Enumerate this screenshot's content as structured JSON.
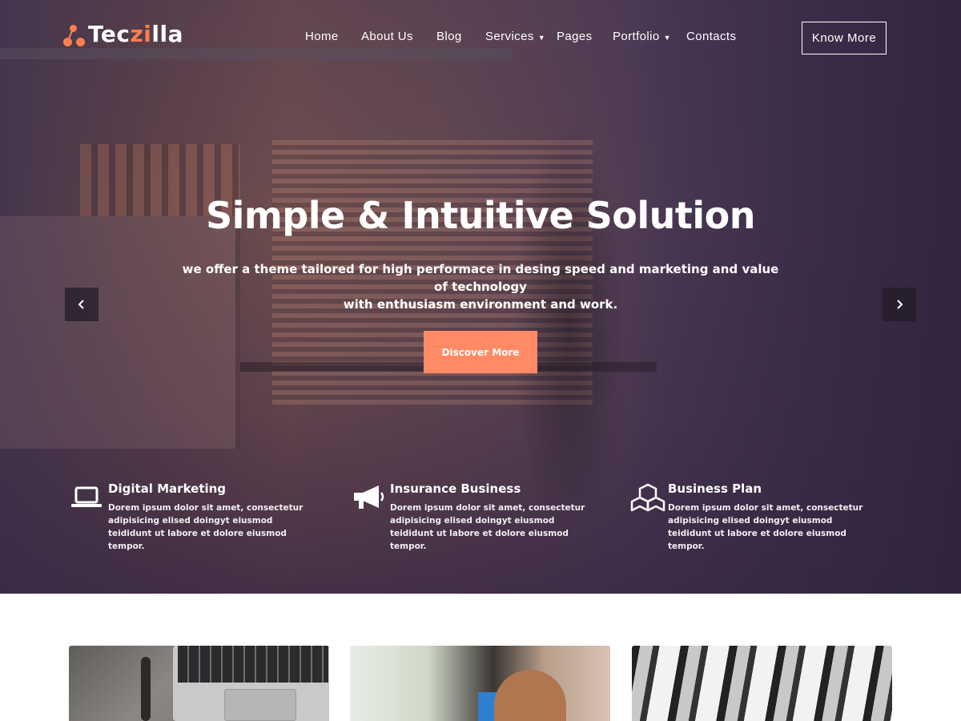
{
  "brand": {
    "logo_prefix": "Tec",
    "logo_accent": "zi",
    "logo_suffix": "lla",
    "accent_color": "#ff7f50"
  },
  "nav": {
    "items": [
      {
        "label": "Home",
        "has_dropdown": false
      },
      {
        "label": "About Us",
        "has_dropdown": false
      },
      {
        "label": "Blog",
        "has_dropdown": false
      },
      {
        "label": "Services",
        "has_dropdown": true
      },
      {
        "label": "Pages",
        "has_dropdown": false
      },
      {
        "label": "Portfolio",
        "has_dropdown": true
      },
      {
        "label": "Contacts",
        "has_dropdown": false
      }
    ],
    "cta_label": "Know More"
  },
  "hero": {
    "title": "Simple & Intuitive Solution",
    "subtitle_line1": "we offer a theme tailored for high performace in desing speed and marketing and value of technology",
    "subtitle_line2": "with enthusiasm environment and work.",
    "button_label": "Discover More",
    "button_color": "#ff8a65",
    "prev_icon": "chevron-left-icon",
    "next_icon": "chevron-right-icon"
  },
  "features": [
    {
      "icon": "laptop-icon",
      "title": "Digital Marketing",
      "desc": "Dorem ipsum dolor sit amet, consectetur adipisicing elised doingyt eiusmod teididunt ut labore et dolore eiusmod tempor."
    },
    {
      "icon": "megaphone-icon",
      "title": "Insurance Business",
      "desc": "Dorem ipsum dolor sit amet, consectetur adipisicing elised doingyt eiusmod teididunt ut labore et dolore eiusmod tempor."
    },
    {
      "icon": "cubes-icon",
      "title": "Business Plan",
      "desc": "Dorem ipsum dolor sit amet, consectetur adipisicing elised doingyt eiusmod teididunt ut labore et dolore eiusmod tempor."
    }
  ]
}
